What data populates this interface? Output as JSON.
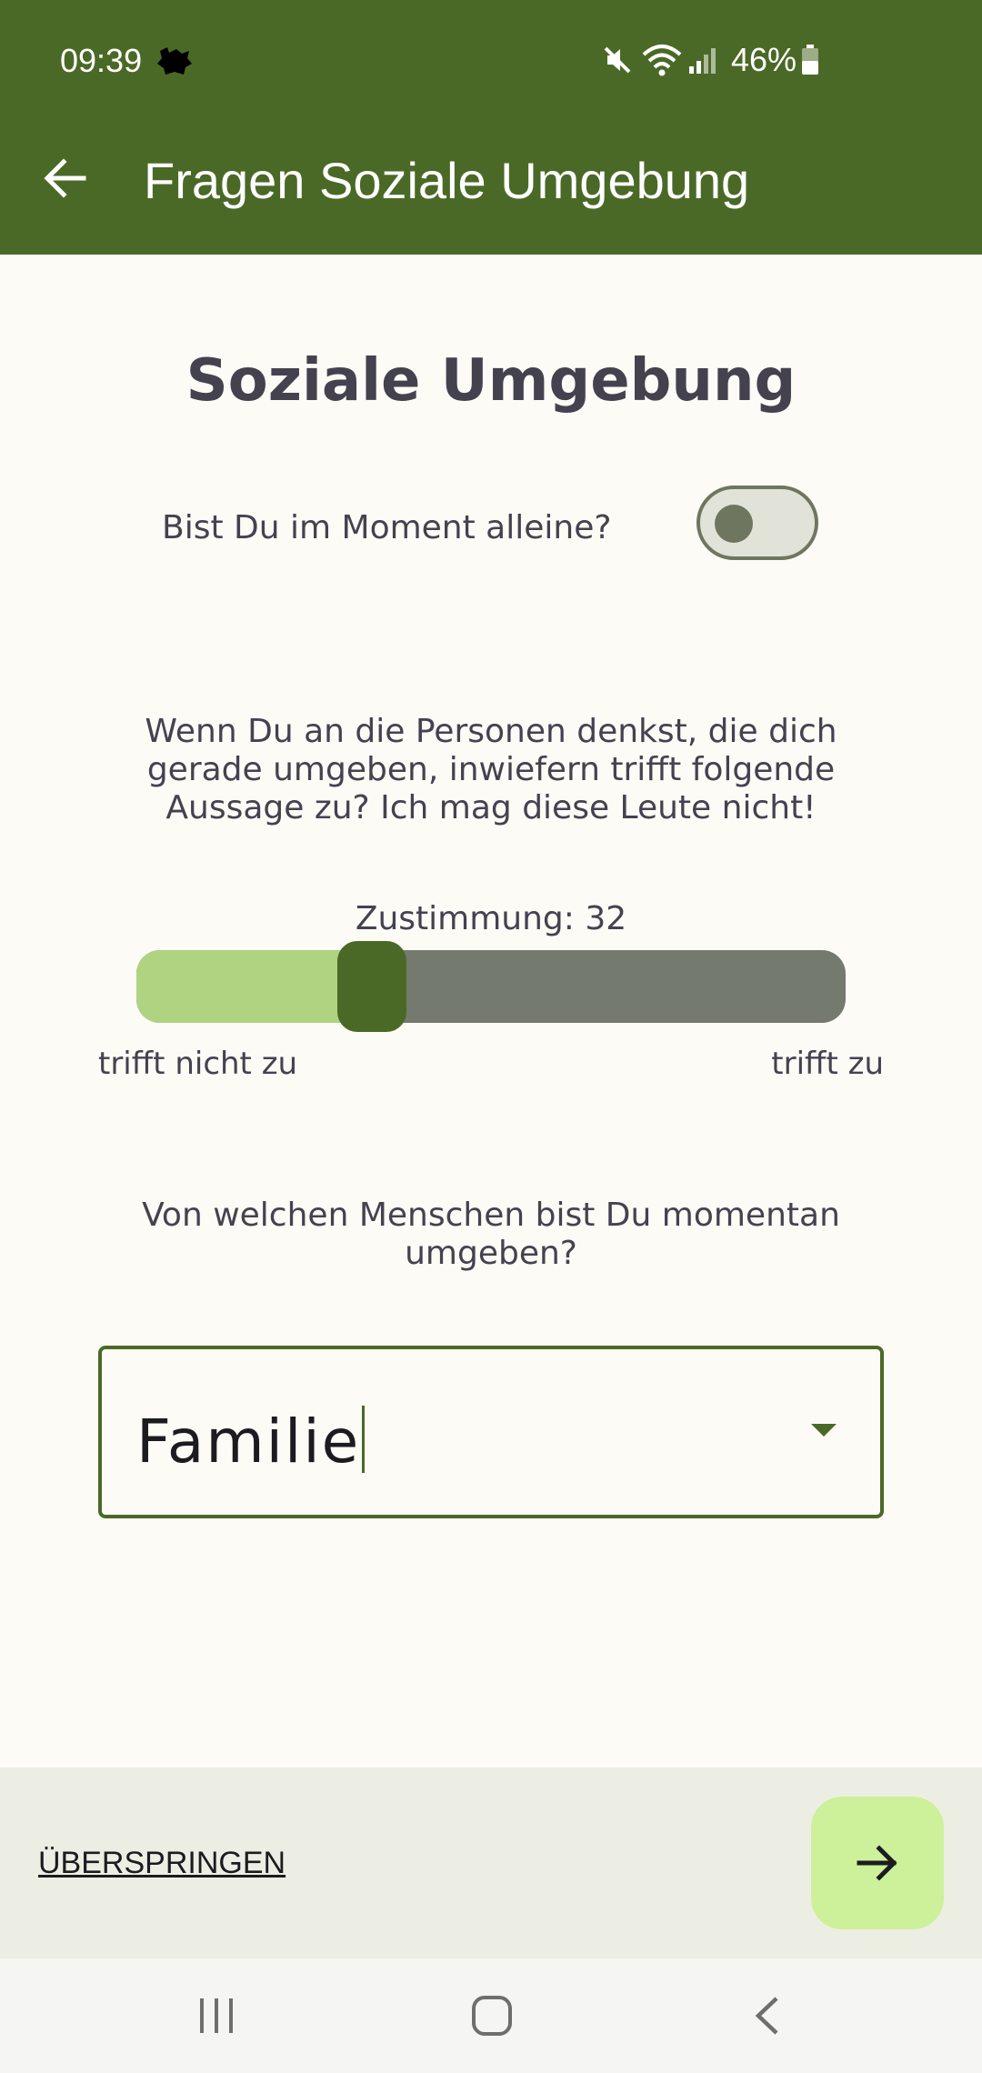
{
  "status_bar": {
    "time": "09:39",
    "battery_text": "46%",
    "battery_level_percent": 46,
    "icons": [
      "app-notification-icon",
      "mute-icon",
      "wifi-icon",
      "signal-icon",
      "battery-icon"
    ]
  },
  "app_bar": {
    "title": "Fragen Soziale Umgebung",
    "back_icon": "arrow-left-icon"
  },
  "main": {
    "section_title": "Soziale Umgebung",
    "alone_question": "Bist Du im Moment alleine?",
    "alone_toggle_on": false,
    "statement_question": "Wenn Du an die Personen denkst, die dich gerade umgeben, inwiefern trifft folgende Aussage zu? Ich mag diese Leute nicht!",
    "slider": {
      "value_label": "Zustimmung: 32",
      "value": 32,
      "min": 0,
      "max": 100,
      "min_label": "trifft nicht zu",
      "max_label": "trifft zu"
    },
    "people_question": "Von welchen Menschen bist Du momentan umgeben?",
    "people_dropdown": {
      "selected": "Familie",
      "arrow_icon": "dropdown-arrow-icon"
    }
  },
  "bottom_bar": {
    "skip_label": "ÜBERSPRINGEN",
    "next_icon": "arrow-right-icon"
  },
  "nav_bar": {
    "icons": [
      "recent-apps-icon",
      "home-icon",
      "back-icon"
    ]
  },
  "colors": {
    "primary": "#4a6926",
    "slider_fill": "#b0d382",
    "slider_track": "#757a6f",
    "next_button": "#cdf09b",
    "background": "#fcfbf6",
    "bottom_bar": "#edeee3"
  }
}
